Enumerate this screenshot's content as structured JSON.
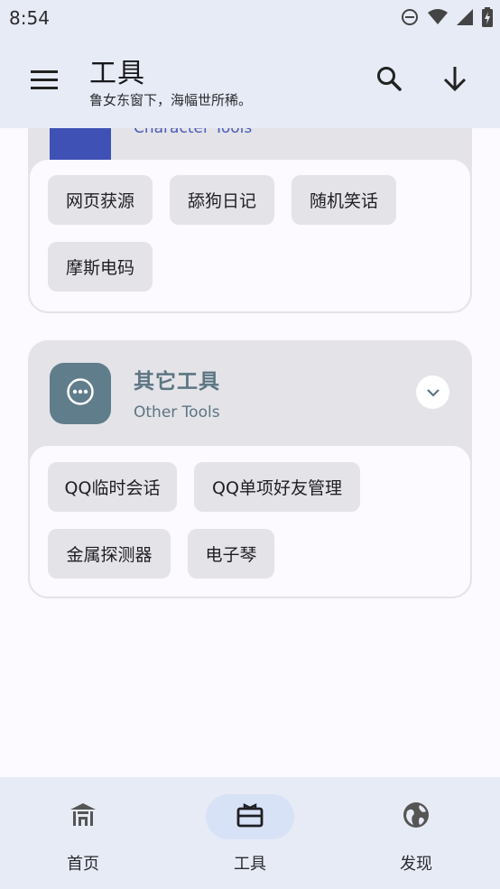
{
  "status": {
    "time": "8:54",
    "icons": [
      "do-not-disturb-icon",
      "wifi-icon",
      "signal-icon",
      "battery-charging-icon"
    ]
  },
  "app_bar": {
    "title": "工具",
    "subtitle": "鲁女东窗下，海幅世所稀。",
    "menu_icon": "menu-icon",
    "search_icon": "search-icon",
    "download_icon": "arrow-down-icon"
  },
  "character_tools": {
    "subtitle": "Character Tools",
    "icon_color": "#3f51b5",
    "chips": [
      "网页获源",
      "舔狗日记",
      "随机笑话",
      "摩斯电码"
    ]
  },
  "other_tools": {
    "title": "其它工具",
    "subtitle": "Other Tools",
    "icon": "more-horizontal-icon",
    "icon_color": "#607d8b",
    "chips": [
      "QQ临时会话",
      "QQ单项好友管理",
      "金属探测器",
      "电子琴"
    ]
  },
  "bottom_nav": {
    "items": [
      {
        "label": "首页",
        "icon": "home-icon",
        "active": false
      },
      {
        "label": "工具",
        "icon": "toolbox-icon",
        "active": true
      },
      {
        "label": "发现",
        "icon": "globe-icon",
        "active": false
      }
    ]
  },
  "colors": {
    "app_bar_bg": "#e7ebf5",
    "card_bg": "#e3e3e8",
    "accent": "#5d7582",
    "active_nav_pill": "#d8e2f7"
  }
}
